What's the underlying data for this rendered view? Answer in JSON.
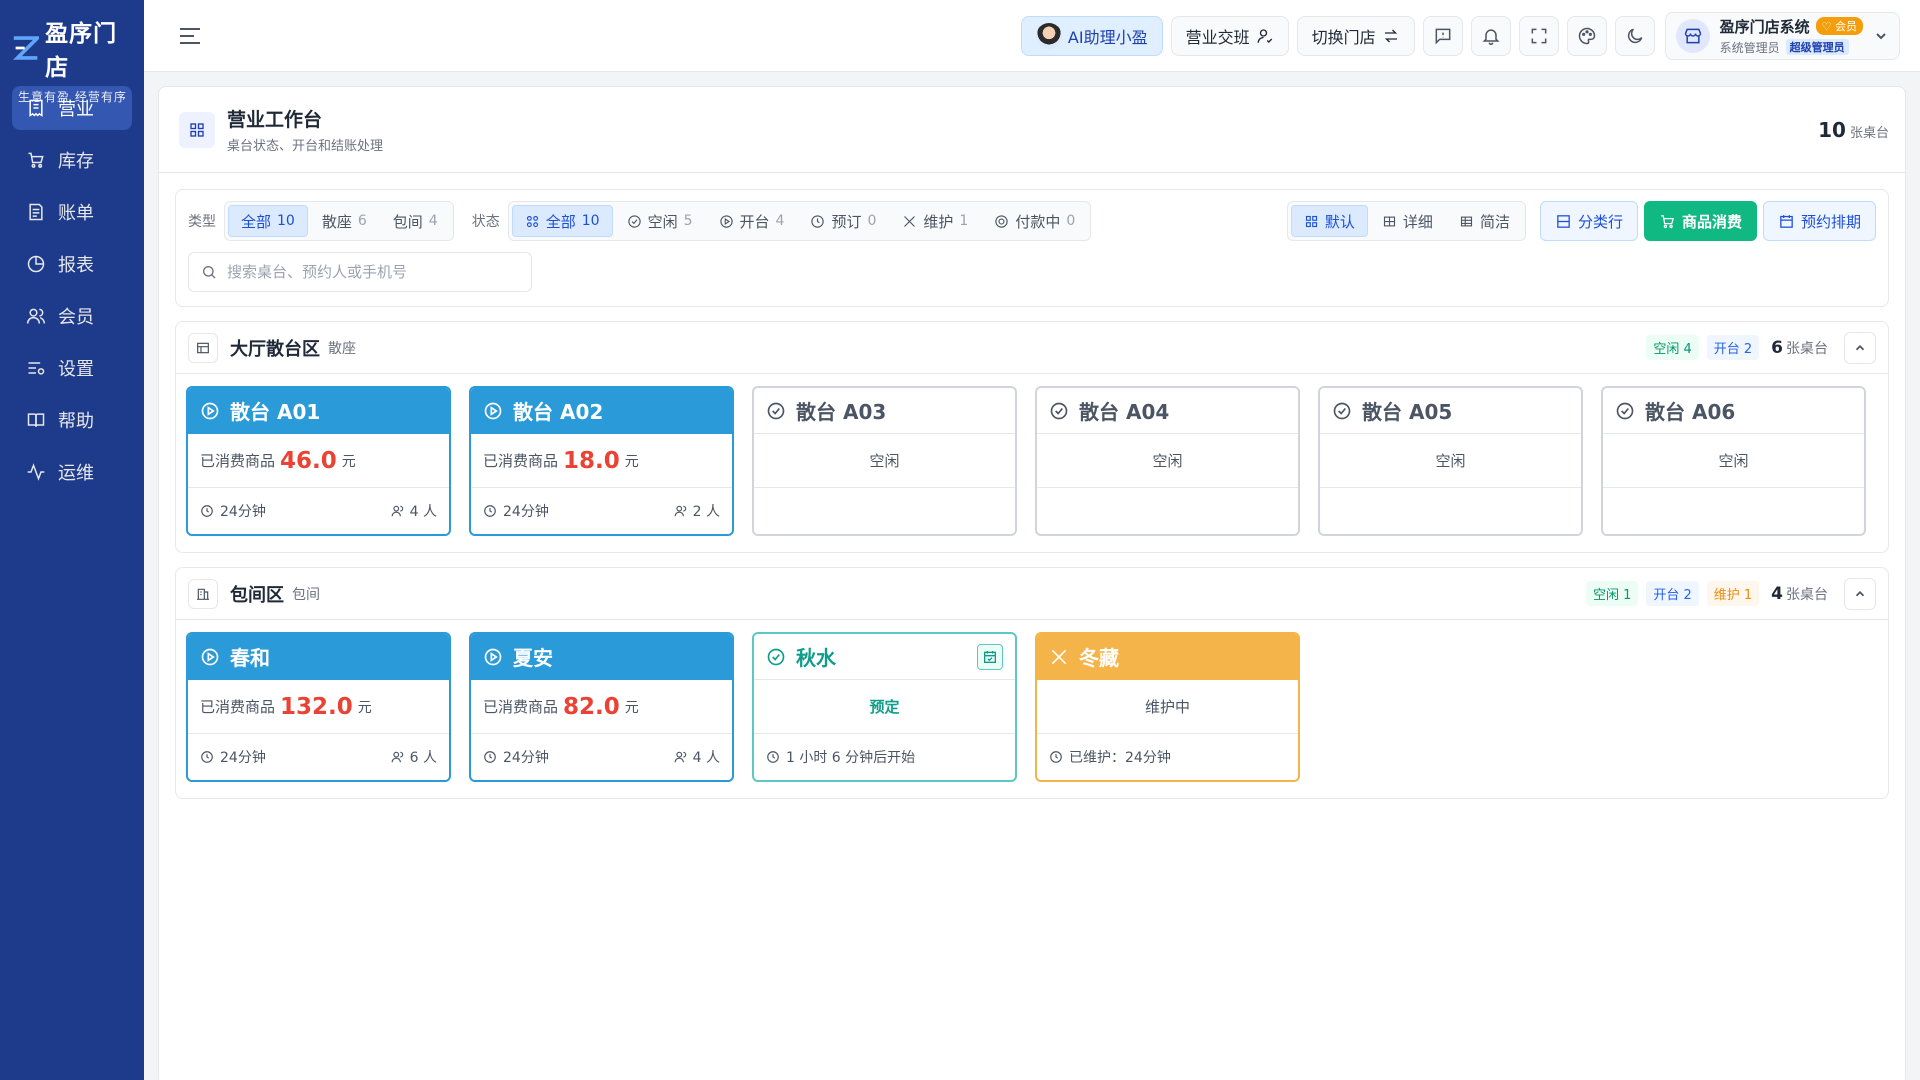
{
  "brand": {
    "name": "盈序门店",
    "slogan": "生意有盈 经营有序",
    "color": "#1e3a8a"
  },
  "nav": [
    {
      "label": "营业",
      "icon": "receipt-icon",
      "active": true
    },
    {
      "label": "库存",
      "icon": "cart-icon"
    },
    {
      "label": "账单",
      "icon": "bill-icon"
    },
    {
      "label": "报表",
      "icon": "pie-chart-icon"
    },
    {
      "label": "会员",
      "icon": "users-icon"
    },
    {
      "label": "设置",
      "icon": "settings-list-icon"
    },
    {
      "label": "帮助",
      "icon": "book-icon"
    },
    {
      "label": "运维",
      "icon": "activity-icon"
    }
  ],
  "topbar": {
    "ai_label": "AI助理小盈",
    "shift_label": "营业交班",
    "switch_store_label": "切换门店",
    "user": {
      "system": "盈序门店系统",
      "vip": "会员",
      "name": "系统管理员",
      "role": "超级管理员"
    }
  },
  "page": {
    "title": "营业工作台",
    "subtitle": "桌台状态、开台和结账处理",
    "count": "10",
    "count_unit": "张桌台"
  },
  "filters": {
    "type_label": "类型",
    "types": [
      {
        "label": "全部",
        "count": "10",
        "active": true
      },
      {
        "label": "散座",
        "count": "6"
      },
      {
        "label": "包间",
        "count": "4"
      }
    ],
    "status_label": "状态",
    "statuses": [
      {
        "label": "全部",
        "count": "10",
        "active": true
      },
      {
        "label": "空闲",
        "count": "5"
      },
      {
        "label": "开台",
        "count": "4"
      },
      {
        "label": "预订",
        "count": "0"
      },
      {
        "label": "维护",
        "count": "1"
      },
      {
        "label": "付款中",
        "count": "0"
      }
    ],
    "views": [
      "默认",
      "详细",
      "简洁"
    ],
    "category_btn": "分类行",
    "consume_btn": "商品消费",
    "schedule_btn": "预约排期",
    "search_placeholder": "搜索桌台、预约人或手机号"
  },
  "zones": [
    {
      "name": "大厅散台区",
      "type": "散座",
      "tags": [
        {
          "text": "空闲 4",
          "kind": "free"
        },
        {
          "text": "开台 2",
          "kind": "open"
        }
      ],
      "count": "6",
      "count_unit": "张桌台",
      "tables": [
        {
          "name": "散台 A01",
          "status": "open",
          "label": "已消费商品",
          "amount": "46.0",
          "unit": "元",
          "time": "24分钟",
          "people": "4 人"
        },
        {
          "name": "散台 A02",
          "status": "open",
          "label": "已消费商品",
          "amount": "18.0",
          "unit": "元",
          "time": "24分钟",
          "people": "2 人"
        },
        {
          "name": "散台 A03",
          "status": "free",
          "text": "空闲"
        },
        {
          "name": "散台 A04",
          "status": "free",
          "text": "空闲"
        },
        {
          "name": "散台 A05",
          "status": "free",
          "text": "空闲"
        },
        {
          "name": "散台 A06",
          "status": "free",
          "text": "空闲"
        }
      ]
    },
    {
      "name": "包间区",
      "type": "包间",
      "tags": [
        {
          "text": "空闲 1",
          "kind": "free"
        },
        {
          "text": "开台 2",
          "kind": "open"
        },
        {
          "text": "维护 1",
          "kind": "maint"
        }
      ],
      "count": "4",
      "count_unit": "张桌台",
      "tables": [
        {
          "name": "春和",
          "status": "open",
          "label": "已消费商品",
          "amount": "132.0",
          "unit": "元",
          "time": "24分钟",
          "people": "6 人"
        },
        {
          "name": "夏安",
          "status": "open",
          "label": "已消费商品",
          "amount": "82.0",
          "unit": "元",
          "time": "24分钟",
          "people": "4 人"
        },
        {
          "name": "秋水",
          "status": "reserved",
          "text": "预定",
          "foot": "1 小时 6 分钟后开始"
        },
        {
          "name": "冬藏",
          "status": "maint",
          "text": "维护中",
          "foot": "已维护：24分钟"
        }
      ]
    }
  ]
}
